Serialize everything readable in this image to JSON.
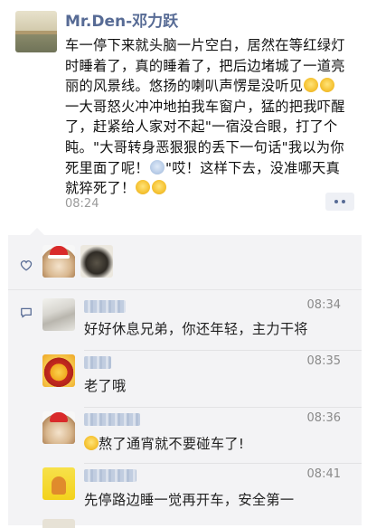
{
  "post": {
    "author": "Mr.Den-邓力跃",
    "lines": [
      "车一停下来就头脑一片空白，居然在等红绿灯",
      "时睡着了，真的睡着了，把后边堵城了一道亮",
      "丽的风景线。悠扬的喇叭声愣是没听见",
      "一大哥怒火冲冲地拍我车窗户，猛的把我吓醒",
      "了，赶紧给人家对不起\"一宿没合眼，打了个",
      "盹。\"大哥转身恶狠狠的丢下一句话\"我以为你",
      "死里面了呢！",
      "\"哎！这样下去，没准哪天真",
      "就猝死了！"
    ],
    "time": "08:24"
  },
  "comments": [
    {
      "time": "08:34",
      "text": "好好休息兄弟，你还年轻，主力干将"
    },
    {
      "time": "08:35",
      "text": "老了哦"
    },
    {
      "time": "08:36",
      "text": "熬了通宵就不要碰车了!"
    },
    {
      "time": "08:41",
      "text": "先停路边睡一觉再开车，安全第一"
    }
  ],
  "icons": {
    "more": "more-dots-icon",
    "like": "heart-icon",
    "comment": "comment-bubble-icon"
  },
  "colors": {
    "name_link": "#576b95",
    "comment_bg": "#f3f3f5"
  }
}
